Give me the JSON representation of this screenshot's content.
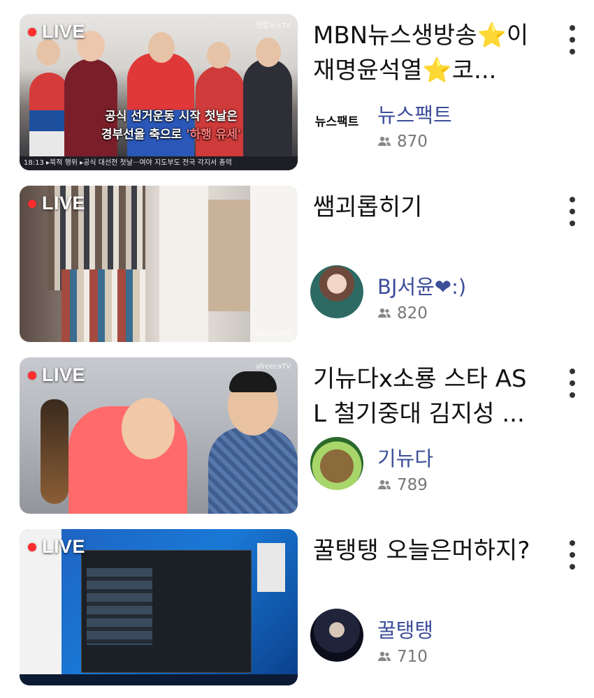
{
  "live_label": "LIVE",
  "items": [
    {
      "title": "MBN뉴스생방송⭐이재명윤석열⭐코...",
      "channel": "뉴스팩트",
      "viewers": "870",
      "caption_line1": "공식 선거운동 시작 첫날은",
      "caption_line2_a": "경부선을 축으로 ",
      "caption_line2_b": "'하행 유세'",
      "ticker": "18:13 ▸북적 행위 ▸공식 대선전 첫날···여야 지도부도 전국 각지서 총력",
      "watermark": "연합뉴스TV",
      "avatar_text": "뉴스팩트"
    },
    {
      "title": "쌤괴롭히기",
      "channel": "BJ서윤❤:)",
      "viewers": "820",
      "watermark": "afreecaTV"
    },
    {
      "title": "기뉴다x소룡 스타 ASL 철기중대 김지성 ...",
      "channel": "기뉴다",
      "viewers": "789",
      "watermark": "afreecaTV"
    },
    {
      "title": "꿀탱탱 오늘은머하지?",
      "channel": "꿀탱탱",
      "viewers": "710"
    }
  ],
  "colors": {
    "channel_text": "#3d4e99",
    "live_dot": "#ff2d2d",
    "viewer_text": "#777777"
  },
  "icons": {
    "viewers": "people-icon",
    "menu": "more-vertical-icon"
  }
}
